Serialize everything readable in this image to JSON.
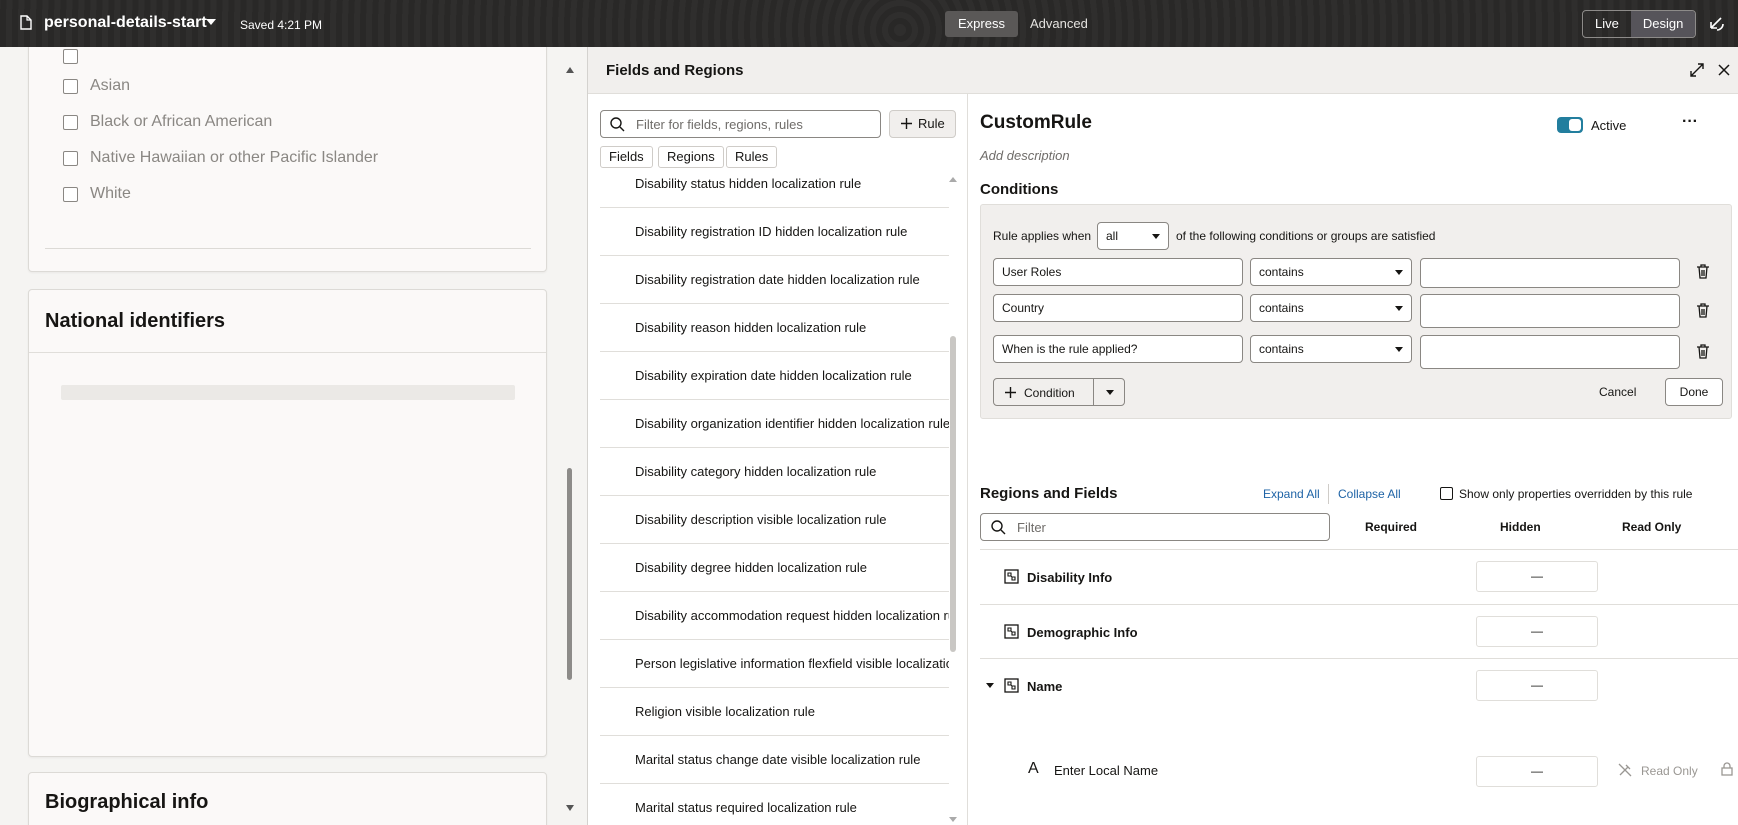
{
  "topbar": {
    "title": "personal-details-start",
    "saved": "Saved 4:21 PM",
    "mode_tabs": [
      "Express",
      "Advanced"
    ],
    "view_toggle": [
      "Live",
      "Design"
    ]
  },
  "canvas": {
    "checkboxes": [
      "Asian",
      "Black or African American",
      "Native Hawaiian or other Pacific Islander",
      "White"
    ],
    "sections": [
      "National identifiers",
      "Biographical info"
    ]
  },
  "panel": {
    "title": "Fields and Regions",
    "search_placeholder": "Filter for fields, regions, rules",
    "rule_button": "Rule",
    "chips": [
      "Fields",
      "Regions",
      "Rules"
    ],
    "rules": [
      "Disability status hidden localization rule",
      "Disability registration ID hidden localization rule",
      "Disability registration date hidden localization rule",
      "Disability reason hidden localization rule",
      "Disability expiration date hidden localization rule",
      "Disability organization identifier hidden localization rule",
      "Disability category hidden localization rule",
      "Disability description visible localization rule",
      "Disability degree hidden localization rule",
      "Disability accommodation request hidden localization rule",
      "Person legislative information flexfield visible localization",
      "Religion visible localization rule",
      "Marital status change date visible localization rule",
      "Marital status required localization rule"
    ]
  },
  "detail": {
    "rule_name": "CustomRule",
    "add_description": "Add description",
    "active_label": "Active",
    "active": true,
    "conditions_heading": "Conditions",
    "applies_when": "Rule applies when",
    "applies_select": "all",
    "applies_suffix": "of the following conditions or groups are satisfied",
    "conditions": [
      {
        "field": "User Roles",
        "op": "contains",
        "value": ""
      },
      {
        "field": "Country",
        "op": "contains",
        "value": ""
      },
      {
        "field": "When is the rule applied?",
        "op": "contains",
        "value": ""
      }
    ],
    "condition_button": "Condition",
    "cancel": "Cancel",
    "done": "Done",
    "regions_heading": "Regions and Fields",
    "expand_all": "Expand All",
    "collapse_all": "Collapse All",
    "show_only": "Show only properties overridden by this rule",
    "filter_placeholder": "Filter",
    "columns": [
      "Required",
      "Hidden",
      "Read Only"
    ],
    "regions": [
      {
        "label": "Disability Info",
        "hidden": "—"
      },
      {
        "label": "Demographic Info",
        "hidden": "—"
      },
      {
        "label": "Name",
        "hidden": "—"
      }
    ],
    "sub_field": {
      "label": "Enter Local Name",
      "hidden": "—",
      "read_only": "Read Only"
    }
  }
}
